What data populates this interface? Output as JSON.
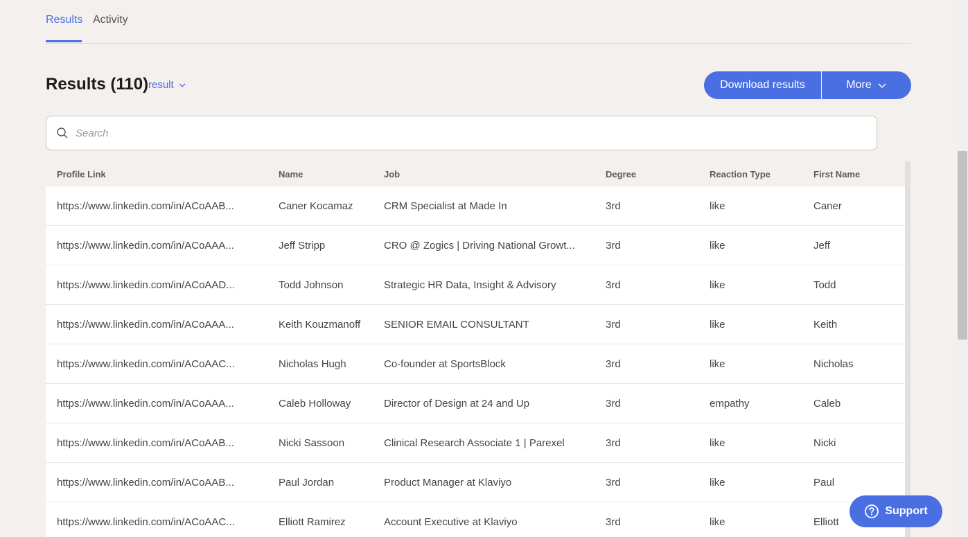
{
  "tabs": [
    {
      "label": "Results",
      "active": true
    },
    {
      "label": "Activity",
      "active": false
    }
  ],
  "header": {
    "title": "Results (110)",
    "result_select": "result",
    "download_label": "Download results",
    "more_label": "More"
  },
  "search": {
    "placeholder": "Search",
    "value": ""
  },
  "table": {
    "columns": [
      "Profile Link",
      "Name",
      "Job",
      "Degree",
      "Reaction Type",
      "First Name"
    ],
    "rows": [
      [
        "https://www.linkedin.com/in/ACoAAB...",
        "Caner Kocamaz",
        "CRM Specialist at Made In",
        "3rd",
        "like",
        "Caner"
      ],
      [
        "https://www.linkedin.com/in/ACoAAA...",
        "Jeff Stripp",
        "CRO @ Zogics | Driving National Growt...",
        "3rd",
        "like",
        "Jeff"
      ],
      [
        "https://www.linkedin.com/in/ACoAAD...",
        "Todd Johnson",
        "Strategic HR Data, Insight & Advisory",
        "3rd",
        "like",
        "Todd"
      ],
      [
        "https://www.linkedin.com/in/ACoAAA...",
        "Keith Kouzmanoff",
        "SENIOR EMAIL CONSULTANT",
        "3rd",
        "like",
        "Keith"
      ],
      [
        "https://www.linkedin.com/in/ACoAAC...",
        "Nicholas Hugh",
        "Co-founder at SportsBlock",
        "3rd",
        "like",
        "Nicholas"
      ],
      [
        "https://www.linkedin.com/in/ACoAAA...",
        "Caleb Holloway",
        "Director of Design at 24 and Up",
        "3rd",
        "empathy",
        "Caleb"
      ],
      [
        "https://www.linkedin.com/in/ACoAAB...",
        "Nicki Sassoon",
        "Clinical Research Associate 1 | Parexel",
        "3rd",
        "like",
        "Nicki"
      ],
      [
        "https://www.linkedin.com/in/ACoAAB...",
        "Paul Jordan",
        "Product Manager at Klaviyo",
        "3rd",
        "like",
        "Paul"
      ],
      [
        "https://www.linkedin.com/in/ACoAAC...",
        "Elliott Ramirez",
        "Account Executive at Klaviyo",
        "3rd",
        "like",
        "Elliott"
      ]
    ]
  },
  "support": {
    "label": "Support"
  },
  "colors": {
    "accent": "#4a6fe3",
    "background": "#f3f0ed"
  },
  "icons": [
    "search-icon",
    "chevron-down-icon",
    "help-circle-icon"
  ]
}
